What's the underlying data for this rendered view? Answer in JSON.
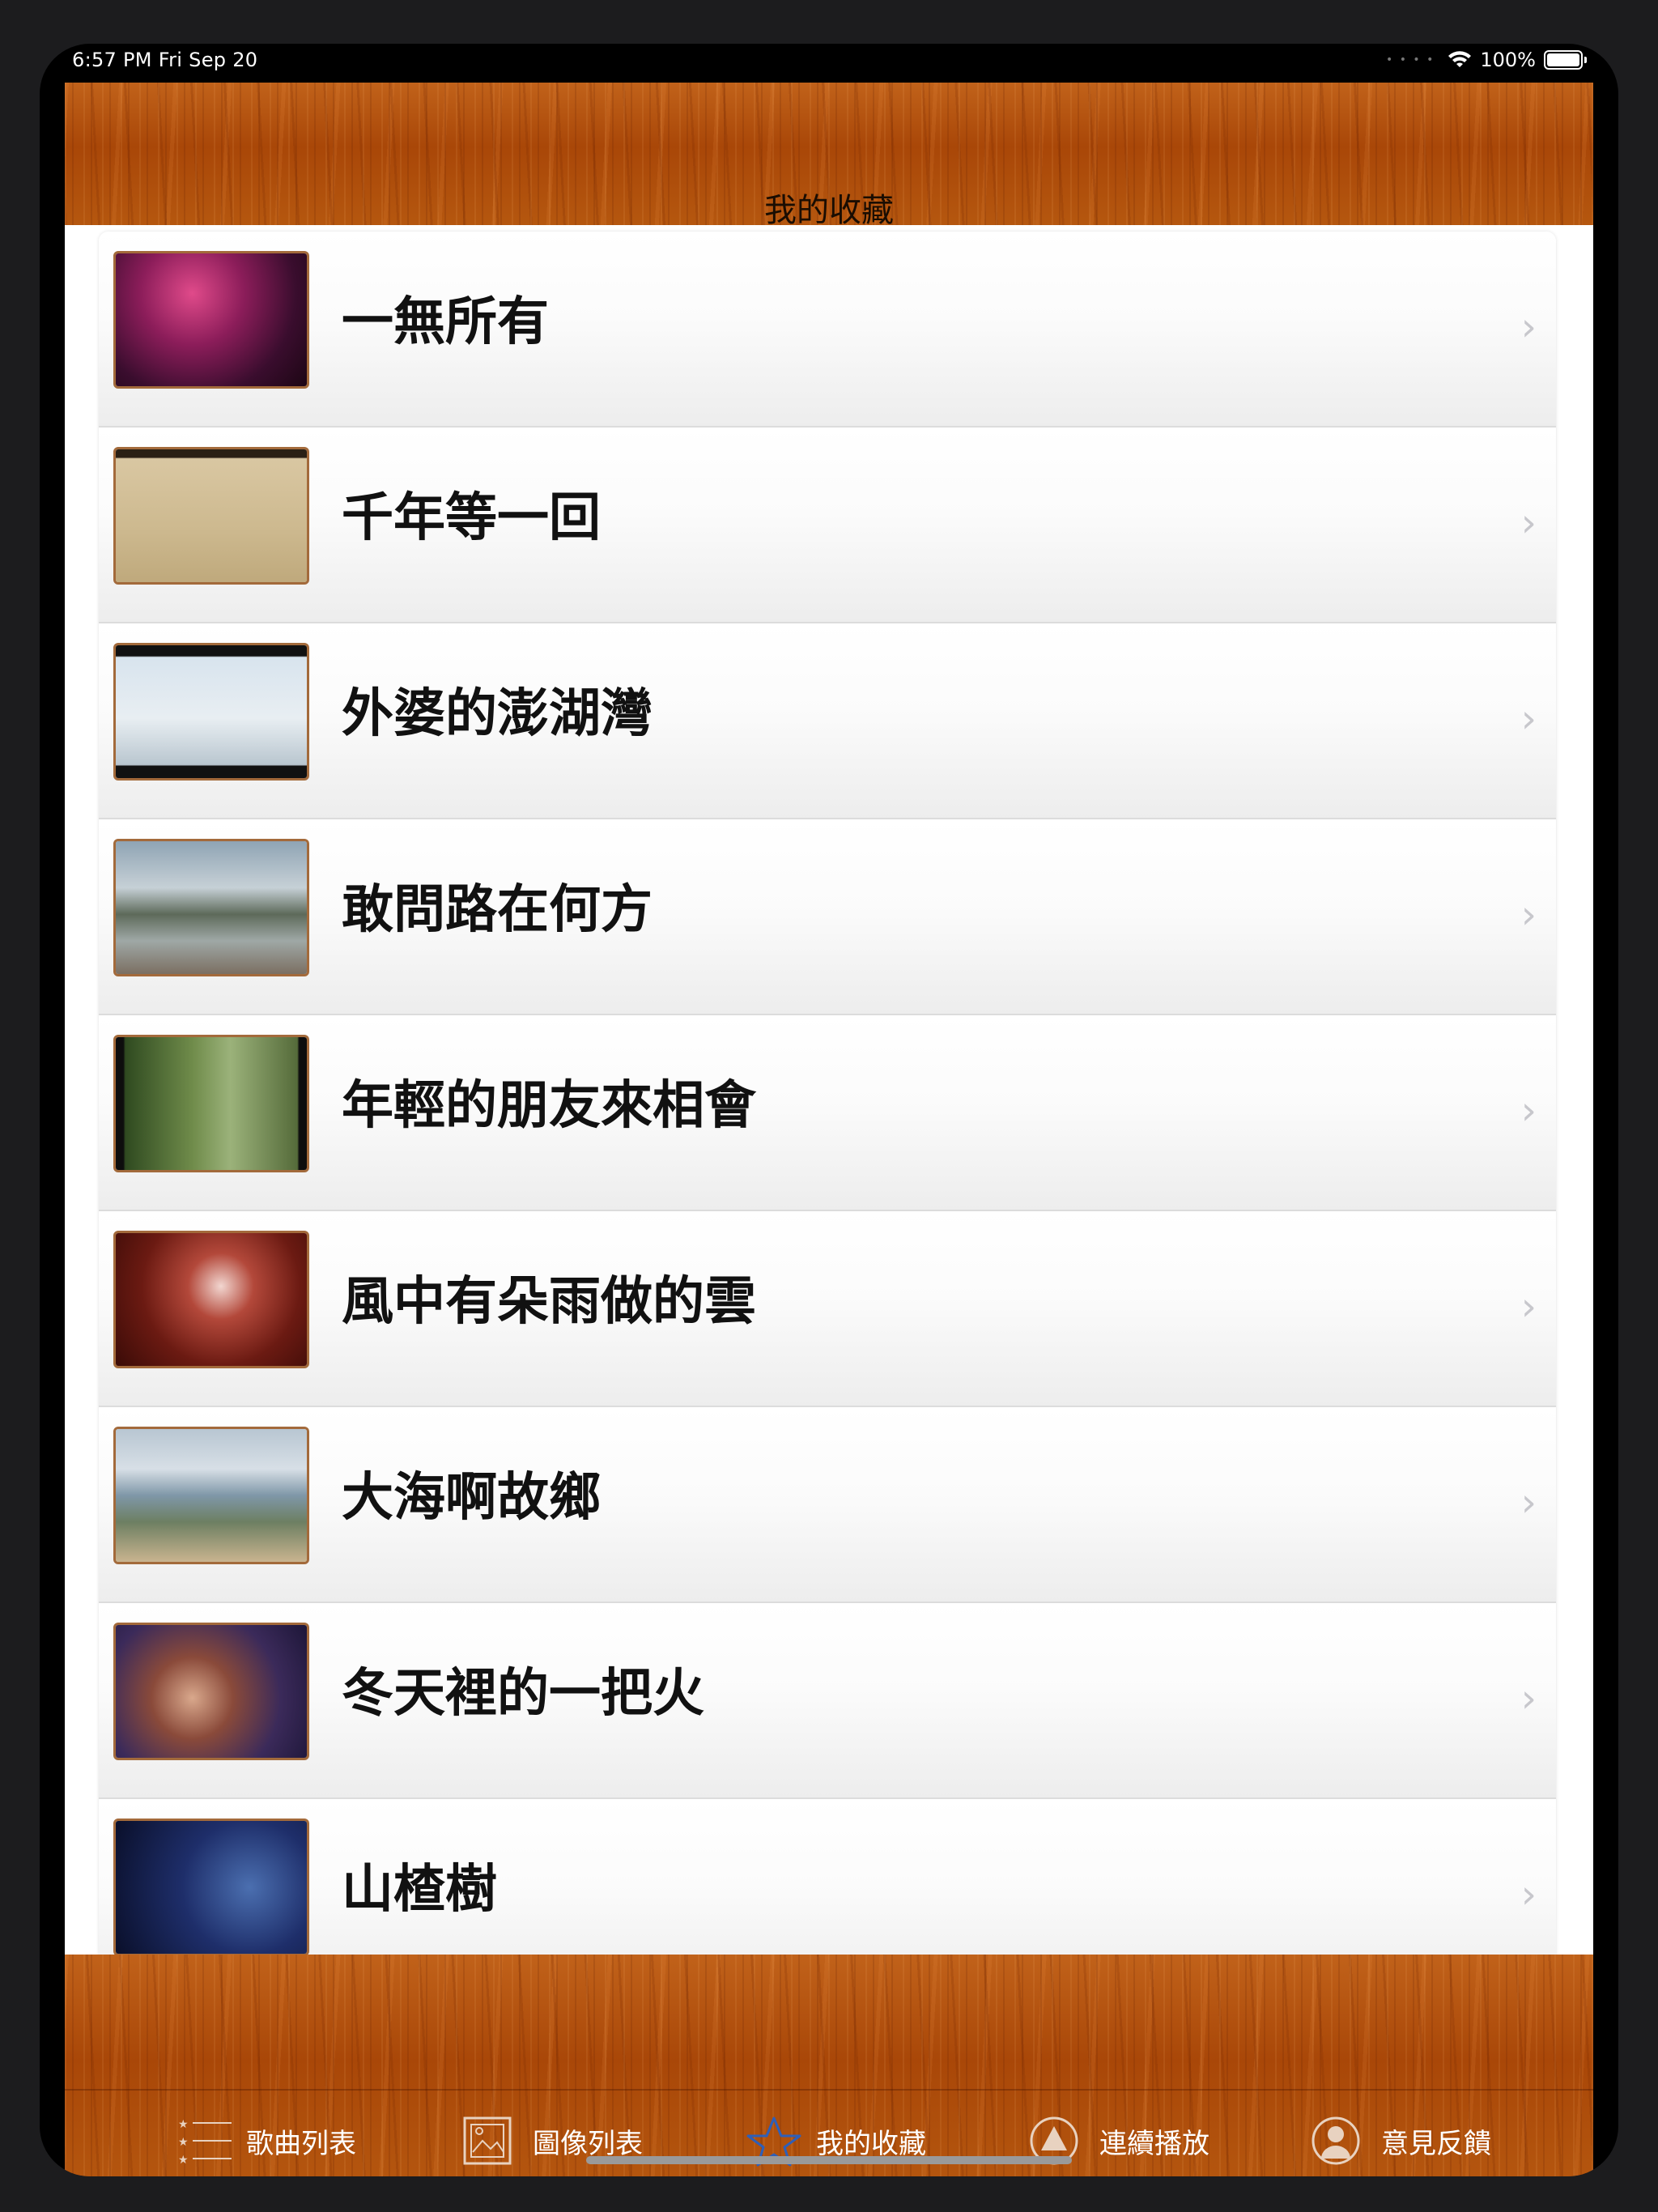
{
  "status_bar": {
    "time_date": "6:57 PM   Fri Sep 20",
    "battery": "100%"
  },
  "nav": {
    "title": "我的收藏"
  },
  "songs": [
    {
      "title": "一無所有"
    },
    {
      "title": "千年等一回"
    },
    {
      "title": "外婆的澎湖灣"
    },
    {
      "title": "敢問路在何方"
    },
    {
      "title": "年輕的朋友來相會"
    },
    {
      "title": "風中有朵雨做的雲"
    },
    {
      "title": "大海啊故鄉"
    },
    {
      "title": "冬天裡的一把火"
    },
    {
      "title": "山楂樹"
    }
  ],
  "tabs": [
    {
      "label": "歌曲列表",
      "icon": "list-icon"
    },
    {
      "label": "圖像列表",
      "icon": "image-list-icon"
    },
    {
      "label": "我的收藏",
      "icon": "star-icon",
      "selected": true
    },
    {
      "label": "連續播放",
      "icon": "play-circle-icon"
    },
    {
      "label": "意見反饋",
      "icon": "person-icon"
    }
  ],
  "colors": {
    "selected_tab_icon": "#2f5fb8",
    "wood": "#b3530e",
    "chevron": "#c7c7cc"
  }
}
